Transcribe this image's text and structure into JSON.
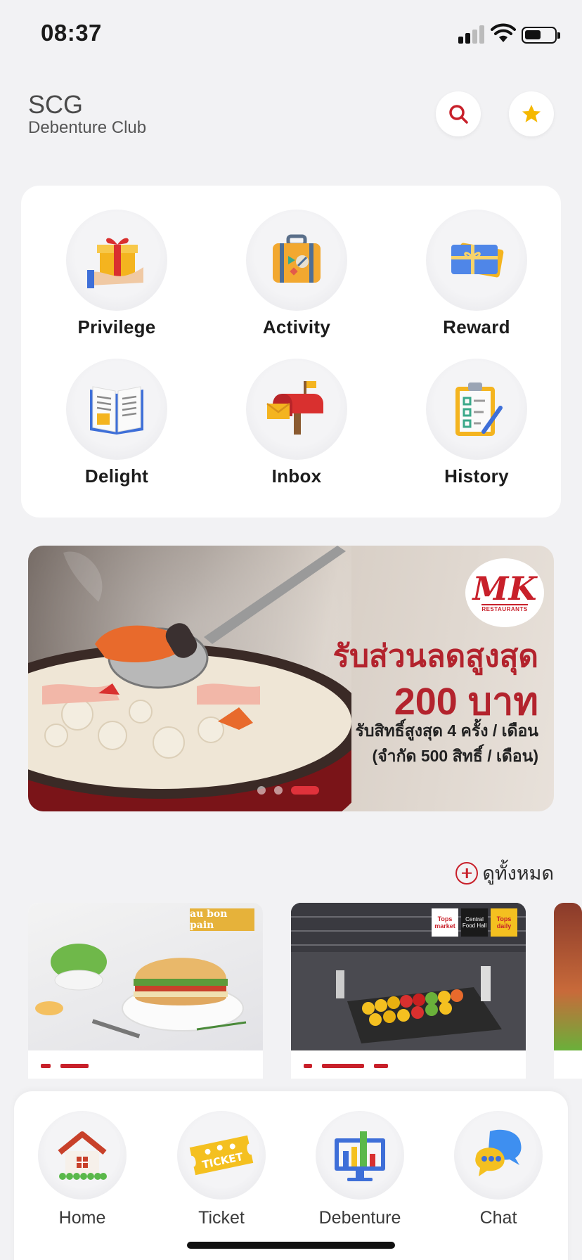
{
  "status_bar": {
    "time": "08:37"
  },
  "header": {
    "title": "SCG",
    "subtitle": "Debenture Club"
  },
  "menu": {
    "items": [
      {
        "label": "Privilege",
        "icon": "gift-icon"
      },
      {
        "label": "Activity",
        "icon": "suitcase-icon"
      },
      {
        "label": "Reward",
        "icon": "gift-card-icon"
      },
      {
        "label": "Delight",
        "icon": "book-icon"
      },
      {
        "label": "Inbox",
        "icon": "mailbox-icon"
      },
      {
        "label": "History",
        "icon": "clipboard-icon"
      }
    ]
  },
  "banner": {
    "brand": "MK",
    "brand_sub": "RESTAURANTS",
    "line1": "รับส่วนลดสูงสุด",
    "line2": "200 บาท",
    "line3": "รับสิทธิ์สูงสุด 4 ครั้ง / เดือน",
    "line4": "(จำกัด 500 สิทธิ์ / เดือน)",
    "slide_count": 3,
    "active_slide": 3
  },
  "promotions": {
    "see_all": "ดูทั้งหมด",
    "cards": [
      {
        "brand_tag": "au bon pain"
      },
      {
        "brand_tags": [
          "Tops market",
          "Central Food Hall",
          "Tops daily"
        ]
      }
    ]
  },
  "bottom_nav": {
    "items": [
      {
        "label": "Home",
        "icon": "house-icon"
      },
      {
        "label": "Ticket",
        "icon": "ticket-icon"
      },
      {
        "label": "Debenture",
        "icon": "monitor-chart-icon"
      },
      {
        "label": "Chat",
        "icon": "chat-bubbles-icon"
      }
    ]
  },
  "colors": {
    "accent": "#c8202a",
    "background": "#f2f2f4",
    "star": "#f5b800"
  }
}
